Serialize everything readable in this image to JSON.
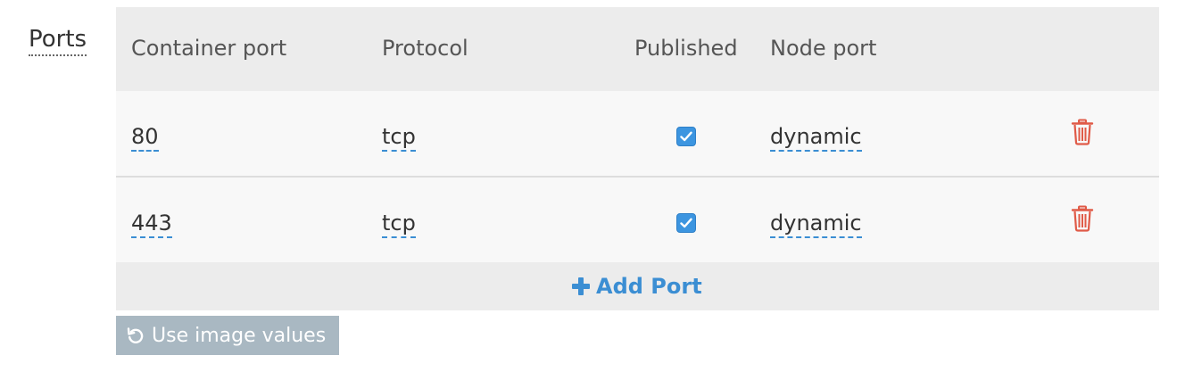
{
  "section": {
    "label": "Ports"
  },
  "table": {
    "headers": {
      "container_port": "Container port",
      "protocol": "Protocol",
      "published": "Published",
      "node_port": "Node port"
    },
    "rows": [
      {
        "container_port": "80",
        "protocol": "tcp",
        "published": true,
        "node_port": "dynamic"
      },
      {
        "container_port": "443",
        "protocol": "tcp",
        "published": true,
        "node_port": "dynamic"
      }
    ]
  },
  "actions": {
    "add_port_label": "Add Port",
    "use_image_values_label": "Use image values"
  },
  "icons": {
    "add": "plus-icon",
    "delete": "trash-icon",
    "checked": "check-icon",
    "reset": "undo-icon"
  },
  "colors": {
    "accent": "#3b8ed3",
    "checkbox": "#3c95e0",
    "delete": "#e05a47",
    "header_bg": "#ececec",
    "row_bg": "#f8f8f8",
    "secondary_button": "#a9b8c2"
  }
}
